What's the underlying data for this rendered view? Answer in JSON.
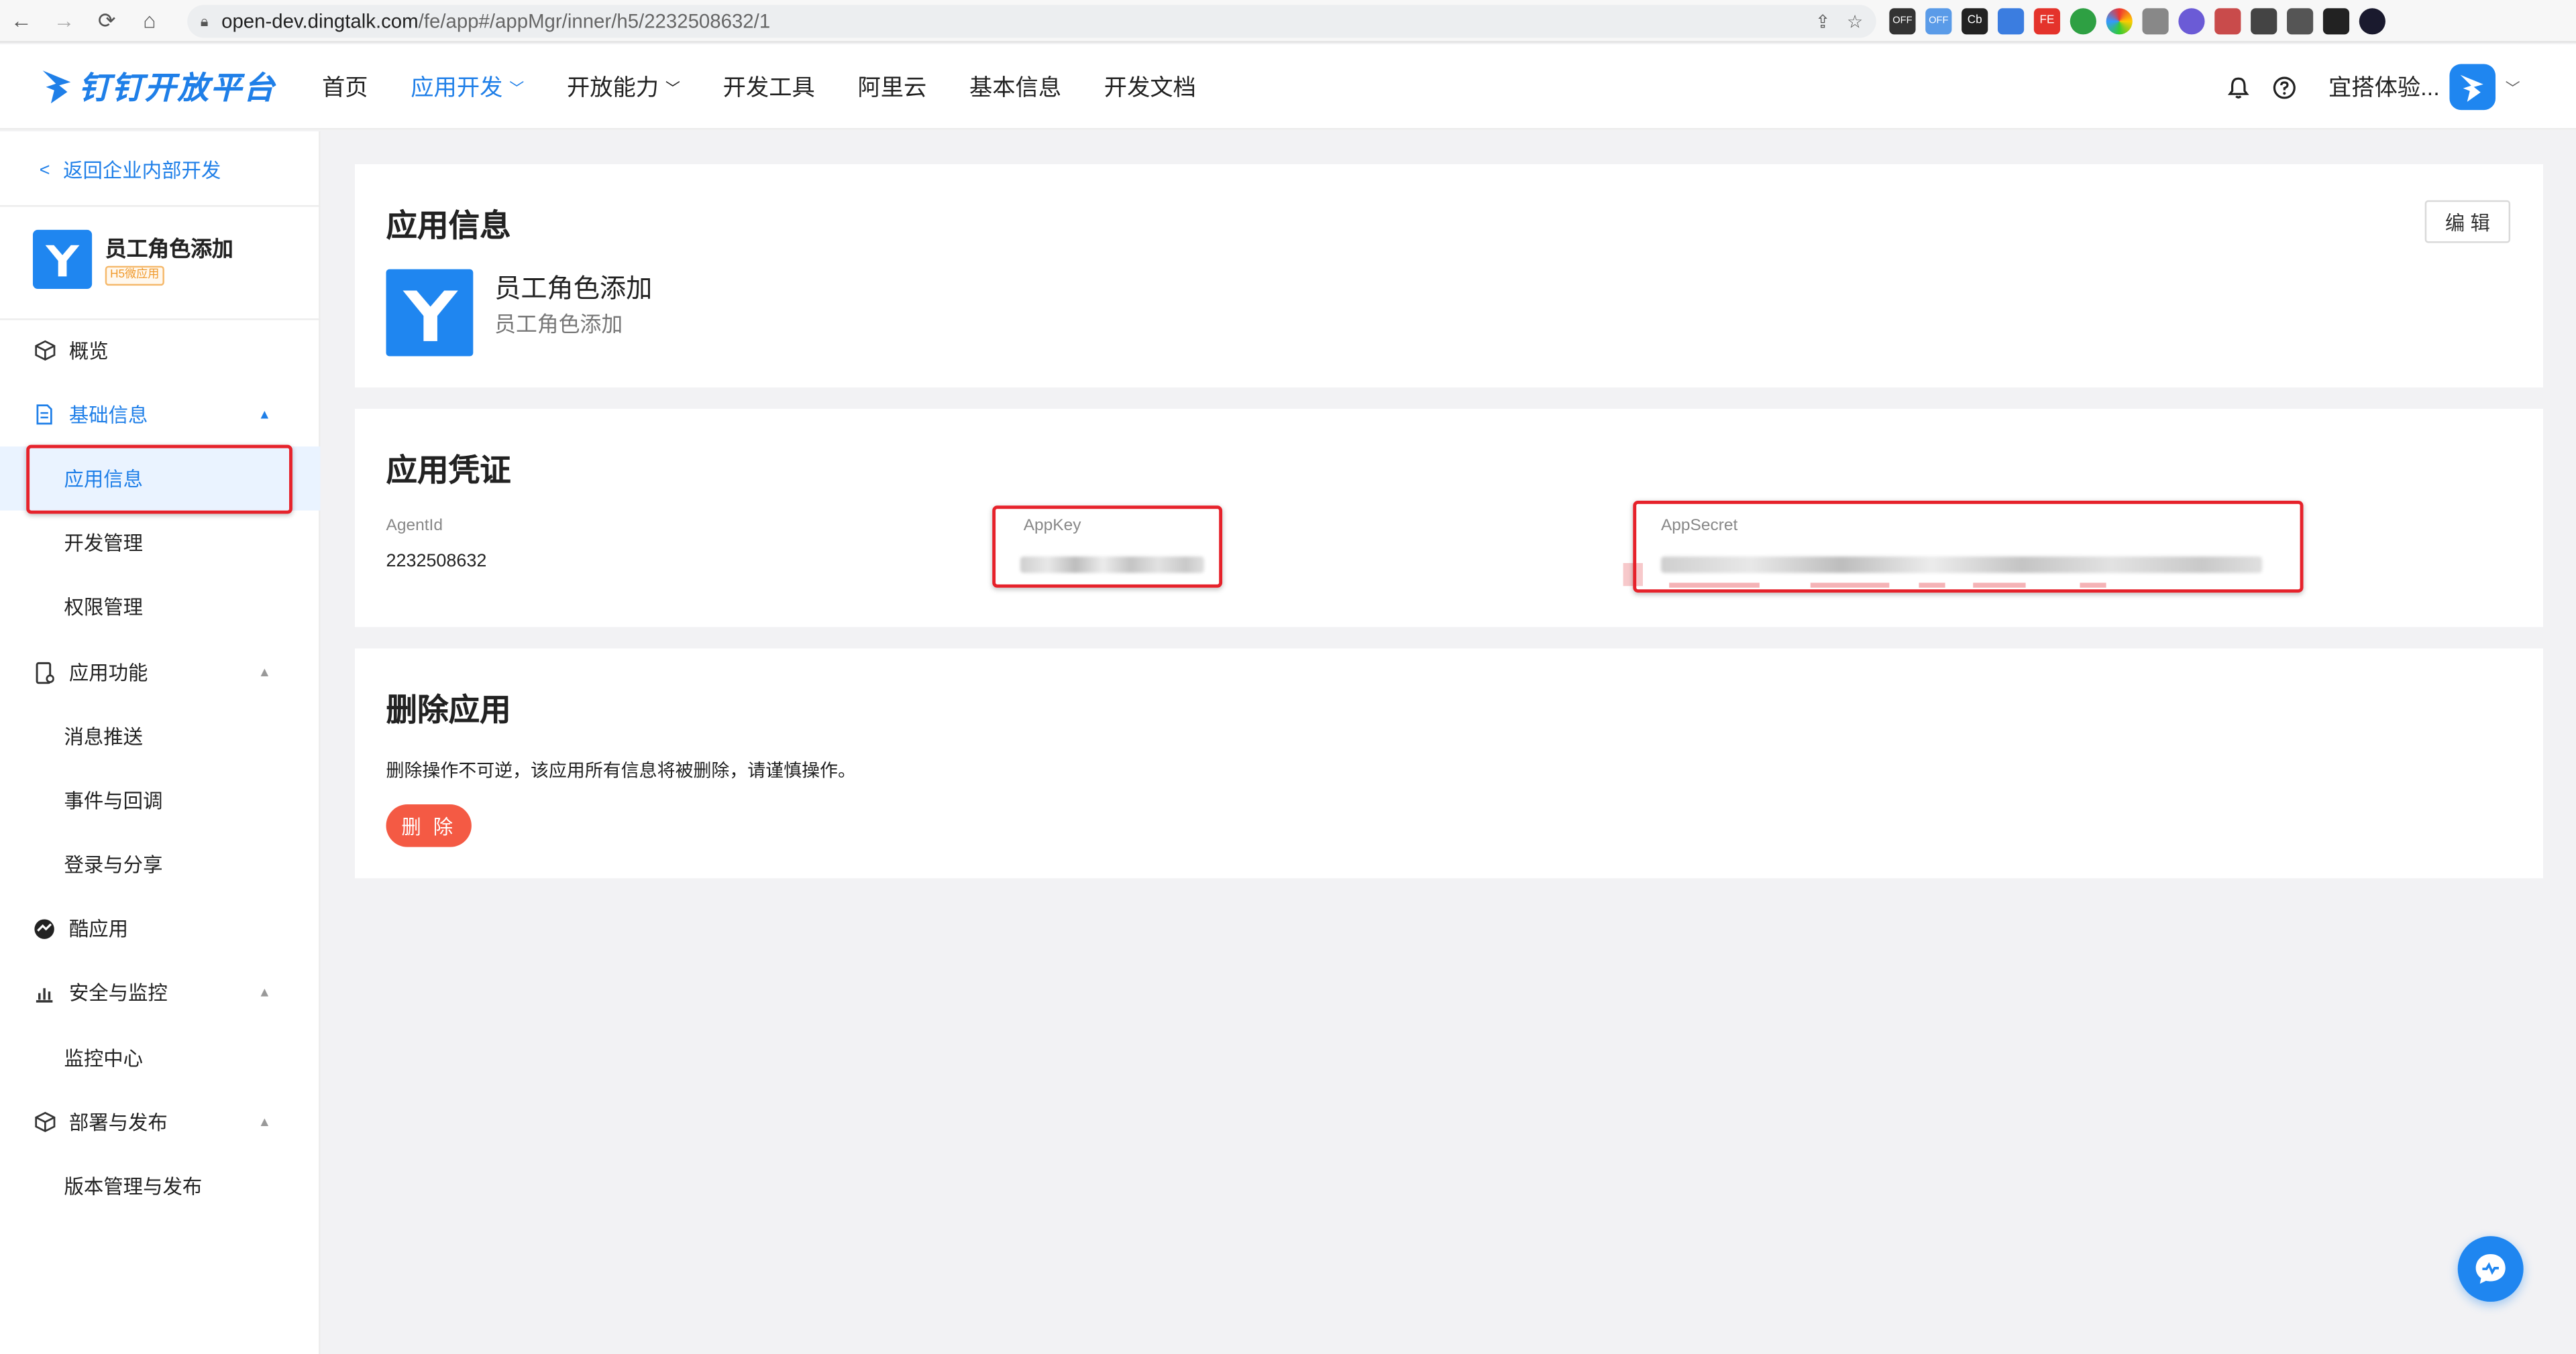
{
  "browser": {
    "url_host": "open-dev.dingtalk.com",
    "url_path": "/fe/app#/appMgr/inner/h5/2232508632/1",
    "ext_off_1": "OFF",
    "ext_off_2": "OFF",
    "ext_cb": "Cb",
    "ext_fe": "FE"
  },
  "header": {
    "logo_text": "钉钉开放平台",
    "nav": [
      {
        "label": "首页"
      },
      {
        "label": "应用开发"
      },
      {
        "label": "开放能力"
      },
      {
        "label": "开发工具"
      },
      {
        "label": "阿里云"
      },
      {
        "label": "基本信息"
      },
      {
        "label": "开发文档"
      }
    ],
    "user_name": "宜搭体验..."
  },
  "sidebar": {
    "back_label": "返回企业内部开发",
    "app_name": "员工角色添加",
    "app_tag": "H5微应用",
    "menu": {
      "overview": "概览",
      "basic_info": "基础信息",
      "app_info": "应用信息",
      "dev_manage": "开发管理",
      "perm_manage": "权限管理",
      "app_function": "应用功能",
      "msg_push": "消息推送",
      "event_callback": "事件与回调",
      "login_share": "登录与分享",
      "cool_app": "酷应用",
      "security_monitor": "安全与监控",
      "monitor_center": "监控中心",
      "deploy_publish": "部署与发布",
      "version_publish": "版本管理与发布"
    }
  },
  "main": {
    "app_info": {
      "title": "应用信息",
      "edit_label": "编 辑",
      "app_name": "员工角色添加",
      "app_desc": "员工角色添加"
    },
    "credentials": {
      "title": "应用凭证",
      "agentid_label": "AgentId",
      "agentid_value": "2232508632",
      "appkey_label": "AppKey",
      "appsecret_label": "AppSecret"
    },
    "delete": {
      "title": "删除应用",
      "description": "删除操作不可逆，该应用所有信息将被删除，请谨慎操作。",
      "button_label": "删 除"
    }
  },
  "colors": {
    "brand": "#1f7fe8",
    "highlight_box": "#e6222b",
    "delete_button": "#f45a44"
  }
}
